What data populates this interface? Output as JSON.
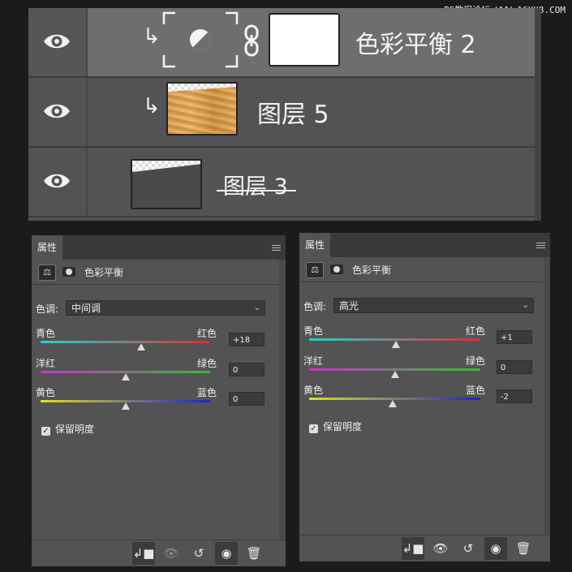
{
  "watermark": "PS教程论坛 WWW.16XX8.COM",
  "layers": [
    {
      "name": "色彩平衡 2",
      "type": "adjustment",
      "selected": true,
      "clipped": true,
      "visible_icon": "eye-icon"
    },
    {
      "name": "图层 5",
      "type": "raster",
      "selected": false,
      "clipped": true,
      "visible_icon": "eye-icon"
    },
    {
      "name": "图层 3",
      "type": "raster",
      "selected": false,
      "clipped": false,
      "struck_through": true,
      "visible_icon": "eye-icon"
    }
  ],
  "panels": [
    {
      "tab": "属性",
      "title": "色彩平衡",
      "tone_label": "色调:",
      "tone_value": "中间调",
      "sliders": [
        {
          "left": "青色",
          "right": "红色",
          "value": "+18",
          "position": 0.595
        },
        {
          "left": "洋红",
          "right": "绿色",
          "value": "0",
          "position": 0.5
        },
        {
          "left": "黄色",
          "right": "蓝色",
          "value": "0",
          "position": 0.5
        }
      ],
      "preserve_label": "保留明度",
      "preserve_checked": true
    },
    {
      "tab": "属性",
      "title": "色彩平衡",
      "tone_label": "色调:",
      "tone_value": "高光",
      "sliders": [
        {
          "left": "青色",
          "right": "红色",
          "value": "+1",
          "position": 0.505
        },
        {
          "left": "洋红",
          "right": "绿色",
          "value": "0",
          "position": 0.5
        },
        {
          "left": "黄色",
          "right": "蓝色",
          "value": "-2",
          "position": 0.49
        }
      ],
      "preserve_label": "保留明度",
      "preserve_checked": true
    }
  ],
  "colors": {
    "cyan": "#22d0d4",
    "red": "#d83030",
    "magenta": "#d030d0",
    "green": "#30c030",
    "yellow": "#e0e020",
    "blue": "#2020d0",
    "panel": "#535353",
    "tabbar": "#3a3a3a"
  },
  "footer_icons": [
    "clip-to-layer-icon",
    "view-previous-icon",
    "reset-icon",
    "visibility-eye-icon",
    "trash-icon"
  ]
}
